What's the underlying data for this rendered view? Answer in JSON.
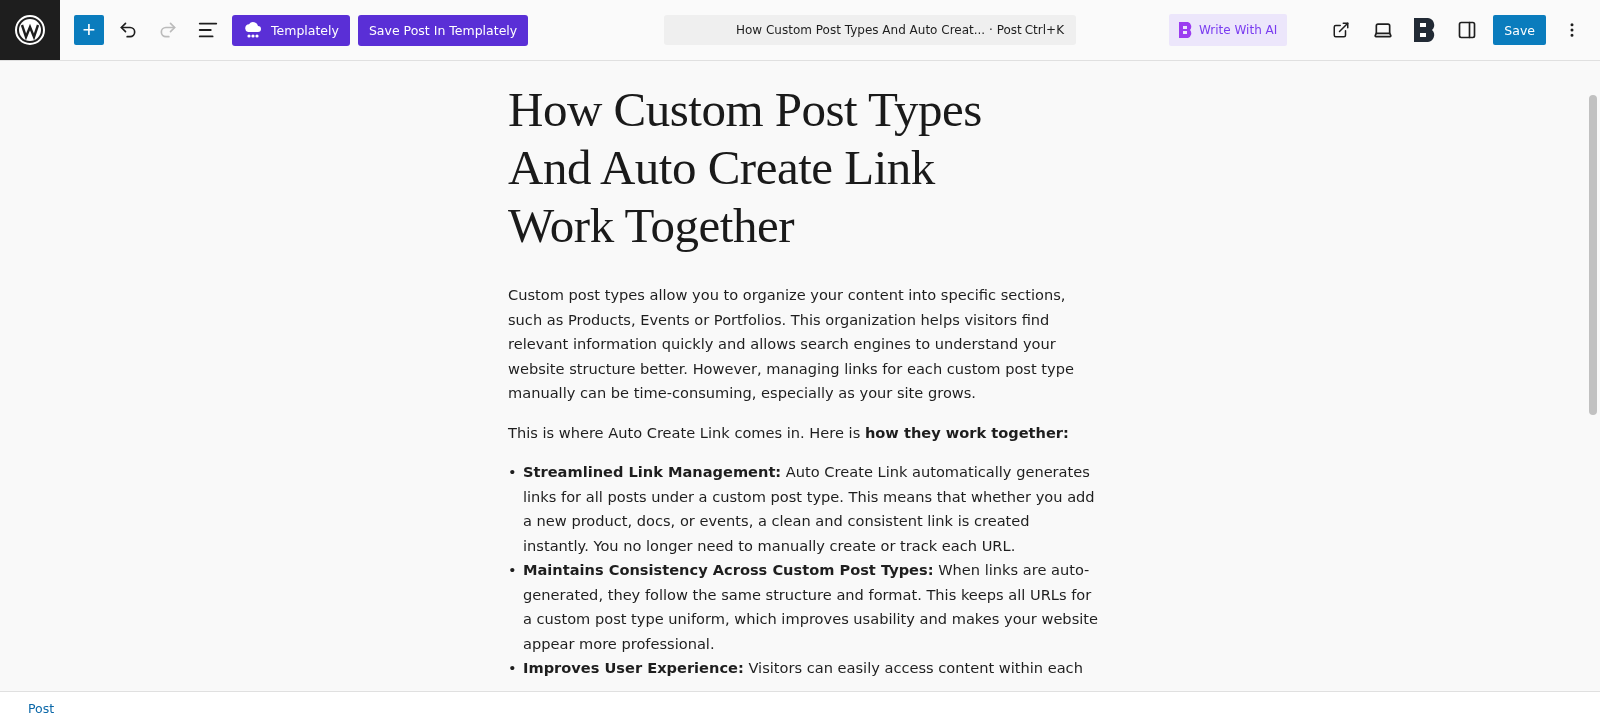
{
  "toolbar": {
    "add_button": {
      "label": "+"
    },
    "undo": {
      "disabled": false
    },
    "redo": {
      "disabled": true
    },
    "templately_button": {
      "label": "Templately"
    },
    "save_templately_button": {
      "label": "Save Post In Templately"
    },
    "command_bar": {
      "title": "How Custom Post Types And Auto Creat... · Post",
      "shortcut": "Ctrl+K"
    },
    "ai_button": {
      "label": "Write With AI"
    },
    "save_button": {
      "label": "Save"
    }
  },
  "post": {
    "title": "How Custom Post Types And Auto Create Link Work Together",
    "paragraphs": [
      "Custom post types allow you to organize your content into specific sections, such as Products, Events or Portfolios. This organization helps visitors find relevant information quickly and allows search engines to understand your website structure better. However, managing links for each custom post type manually can be time-consuming, especially as your site grows.",
      "This is where Auto Create Link comes in. Here is **how they work together:**"
    ],
    "list": [
      {
        "bullet": "•",
        "text": "**Streamlined Link Management:** Auto Create Link automatically generates links for all posts under a custom post type. This means that whether you add a new product, docs, or events, a clean and consistent link is created instantly. You no longer need to manually create or track each URL."
      },
      {
        "bullet": "•",
        "text": "**Maintains Consistency Across Custom Post Types:** When links are auto-generated, they follow the same structure and format. This keeps all URLs for a custom post type uniform, which improves usability and makes your website appear more professional."
      },
      {
        "bullet": "•",
        "text": "**Improves User Experience:** Visitors can easily access content within each"
      }
    ]
  },
  "status_bar": {
    "breadcrumb": "Post"
  }
}
